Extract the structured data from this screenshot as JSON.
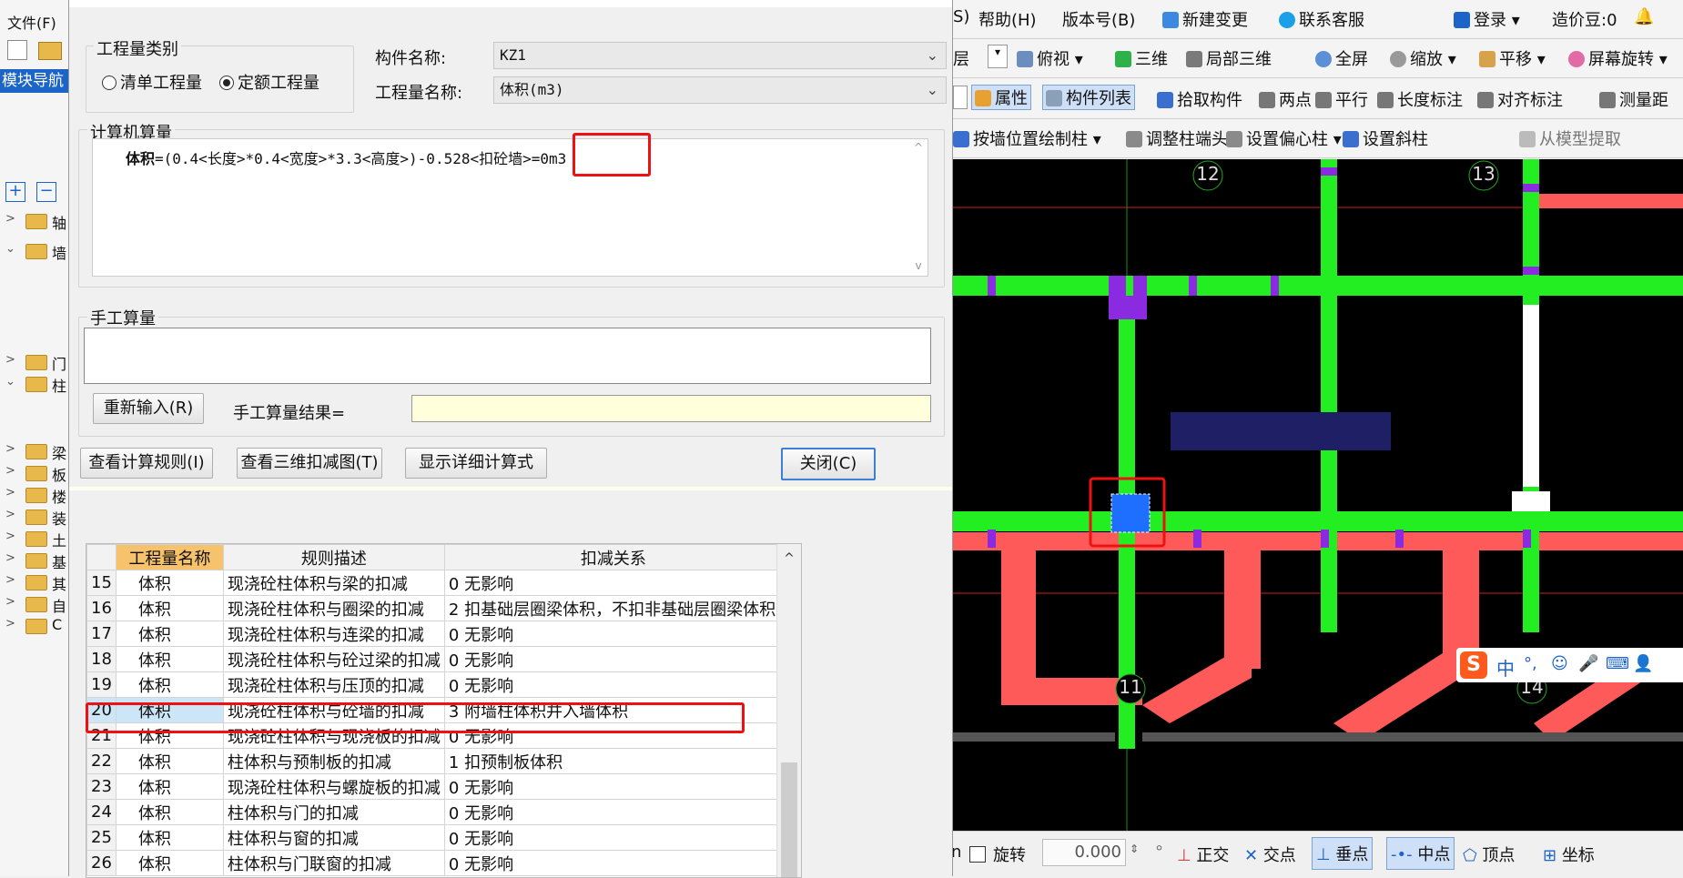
{
  "left_panel": {
    "menu_file": "文件(F)",
    "nav_label": "模块导航",
    "tree": [
      {
        "label": "轴",
        "expanded": false
      },
      {
        "label": "墙",
        "expanded": true
      },
      {
        "label": "门",
        "expanded": false
      },
      {
        "label": "柱",
        "expanded": true
      },
      {
        "label": "梁",
        "expanded": false
      },
      {
        "label": "板",
        "expanded": false
      },
      {
        "label": "楼",
        "expanded": false
      },
      {
        "label": "装",
        "expanded": false
      },
      {
        "label": "土",
        "expanded": false
      },
      {
        "label": "基",
        "expanded": false
      },
      {
        "label": "其",
        "expanded": false
      },
      {
        "label": "自",
        "expanded": false
      },
      {
        "label": "C",
        "expanded": false
      }
    ]
  },
  "dialog": {
    "type_group": "工程量类别",
    "radio_list": "清单工程量",
    "radio_quota": "定额工程量",
    "component_label": "构件名称:",
    "component_value": "KZ1",
    "quantity_label": "工程量名称:",
    "quantity_value": "体积(m3)",
    "computer_group": "计算机算量",
    "formula_prefix": "体积",
    "formula_body": "=(0.4<长度>*0.4<宽度>*3.3<高度>)-0.528<扣砼墙>=0m3",
    "manual_group": "手工算量",
    "reenter_button": "重新输入(R)",
    "manual_result_label": "手工算量结果=",
    "btn_rules": "查看计算规则(I)",
    "btn_3d": "查看三维扣减图(T)",
    "btn_detail": "显示详细计算式",
    "btn_close": "关闭(C)",
    "table": {
      "headers": [
        "工程量名称",
        "规则描述",
        "扣减关系"
      ],
      "rows": [
        {
          "no": "15",
          "name": "体积",
          "rule": "现浇砼柱体积与梁的扣减",
          "rel": "0  无影响"
        },
        {
          "no": "16",
          "name": "体积",
          "rule": "现浇砼柱体积与圈梁的扣减",
          "rel": "2  扣基础层圈梁体积，不扣非基础层圈梁体积"
        },
        {
          "no": "17",
          "name": "体积",
          "rule": "现浇砼柱体积与连梁的扣减",
          "rel": "0  无影响"
        },
        {
          "no": "18",
          "name": "体积",
          "rule": "现浇砼柱体积与砼过梁的扣减",
          "rel": "0  无影响"
        },
        {
          "no": "19",
          "name": "体积",
          "rule": "现浇砼柱体积与压顶的扣减",
          "rel": "0  无影响"
        },
        {
          "no": "20",
          "name": "体积",
          "rule": "现浇砼柱体积与砼墙的扣减",
          "rel": "3  附墙柱体积并入墙体积"
        },
        {
          "no": "21",
          "name": "体积",
          "rule": "现浇砼柱体积与现浇板的扣减",
          "rel": "0  无影响"
        },
        {
          "no": "22",
          "name": "体积",
          "rule": "柱体积与预制板的扣减",
          "rel": "1  扣预制板体积"
        },
        {
          "no": "23",
          "name": "体积",
          "rule": "现浇砼柱体积与螺旋板的扣减",
          "rel": "0  无影响"
        },
        {
          "no": "24",
          "name": "体积",
          "rule": "柱体积与门的扣减",
          "rel": "0  无影响"
        },
        {
          "no": "25",
          "name": "体积",
          "rule": "柱体积与窗的扣减",
          "rel": "0  无影响"
        },
        {
          "no": "26",
          "name": "体积",
          "rule": "柱体积与门联窗的扣减",
          "rel": "0  无影响"
        }
      ]
    }
  },
  "toolbar": {
    "row1": [
      "S)",
      "帮助(H)",
      "版本号(B)",
      "新建变更",
      "联系客服",
      "登录",
      "造价豆:0"
    ],
    "row2": [
      "层",
      "俯视",
      "三维",
      "局部三维",
      "全屏",
      "缩放",
      "平移",
      "屏幕旋转"
    ],
    "row3": [
      "属性",
      "构件列表",
      "拾取构件",
      "两点",
      "平行",
      "长度标注",
      "对齐标注",
      "测量距"
    ],
    "row4": [
      "按墙位置绘制柱",
      "调整柱端头",
      "设置偏心柱",
      "设置斜柱",
      "从模型提取"
    ]
  },
  "canvas": {
    "axis_labels": [
      "12",
      "13",
      "11",
      "14"
    ]
  },
  "statusbar": {
    "rotate": "旋转",
    "angle": "0.000",
    "ortho": "正交",
    "intersect": "交点",
    "perp": "垂点",
    "mid": "中点",
    "vertex": "顶点",
    "coord": "坐标"
  },
  "ime": {
    "lang": "中"
  },
  "colors": {
    "green": "#22ee22",
    "red": "#ff5a5a",
    "purple": "#8a2be2",
    "navy": "#1f1f66",
    "highlight": "#ee1111",
    "selected": "#1e6fff"
  }
}
